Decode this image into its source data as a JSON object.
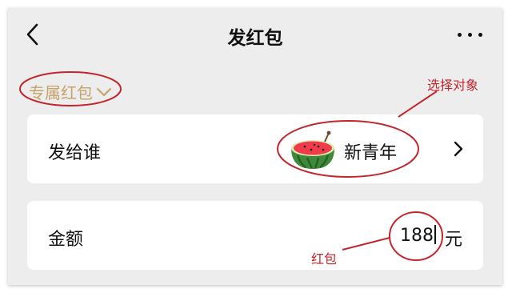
{
  "header": {
    "title": "发红包",
    "back_icon": "chevron-left-icon",
    "more_icon": "more-horizontal-icon"
  },
  "packet_type": {
    "label": "专属红包",
    "icon": "chevron-down-icon",
    "color": "#c4a46a"
  },
  "recipient_row": {
    "label": "发给谁",
    "name": "新青年",
    "avatar_icon": "watermelon-icon",
    "arrow_icon": "chevron-right-icon"
  },
  "amount_row": {
    "label": "金额",
    "value": "188",
    "unit": "元"
  },
  "annotations": {
    "select_target": "选择对象",
    "red_packet": "红包",
    "color": "#c1272d"
  },
  "colors": {
    "background": "#ededed",
    "card": "#ffffff"
  }
}
